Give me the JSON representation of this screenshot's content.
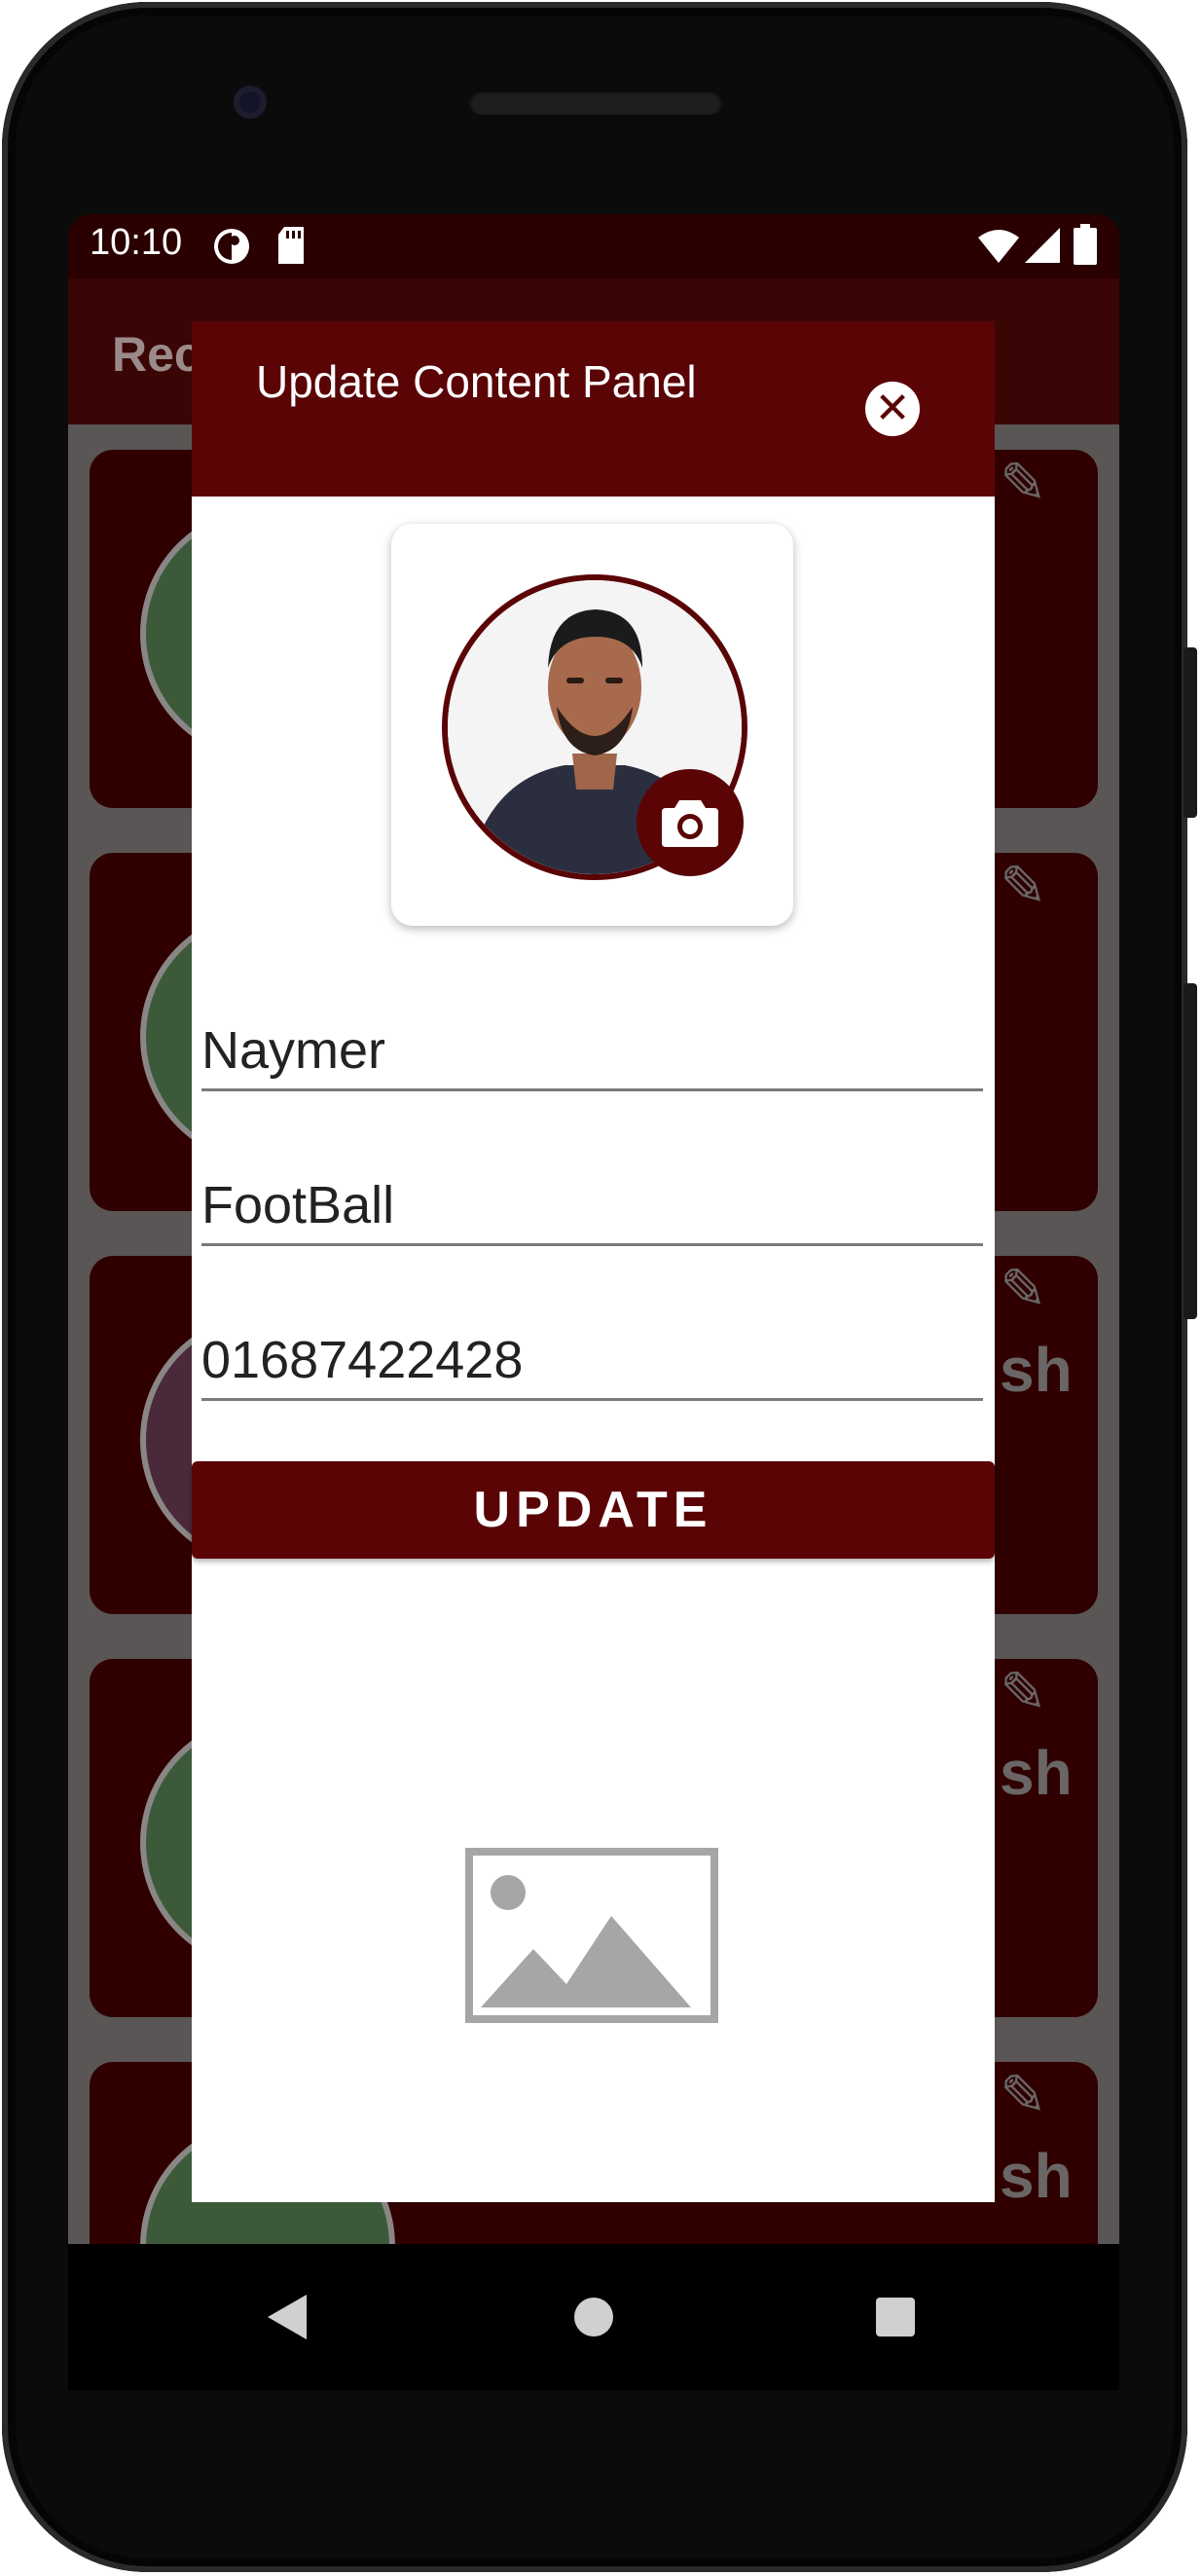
{
  "status_bar": {
    "time": "10:10"
  },
  "app_bar": {
    "title": "Rec"
  },
  "background_cards": {
    "trailing_text": "sh"
  },
  "dialog": {
    "title": "Update Content Panel",
    "close_icon": "close-circle-icon",
    "photo_badge_icon": "camera-icon",
    "fields": {
      "name": "Naymer",
      "category": "FootBall",
      "phone": "01687422428"
    },
    "update_label": "UPDATE",
    "placeholder_icon": "image-placeholder-icon"
  },
  "navigation": {
    "back_icon": "back-triangle-icon",
    "home_icon": "home-circle-icon",
    "recents_icon": "recents-square-icon"
  },
  "colors": {
    "primary": "#5a0406",
    "scrim": "#5a5656",
    "card": "#300000"
  }
}
